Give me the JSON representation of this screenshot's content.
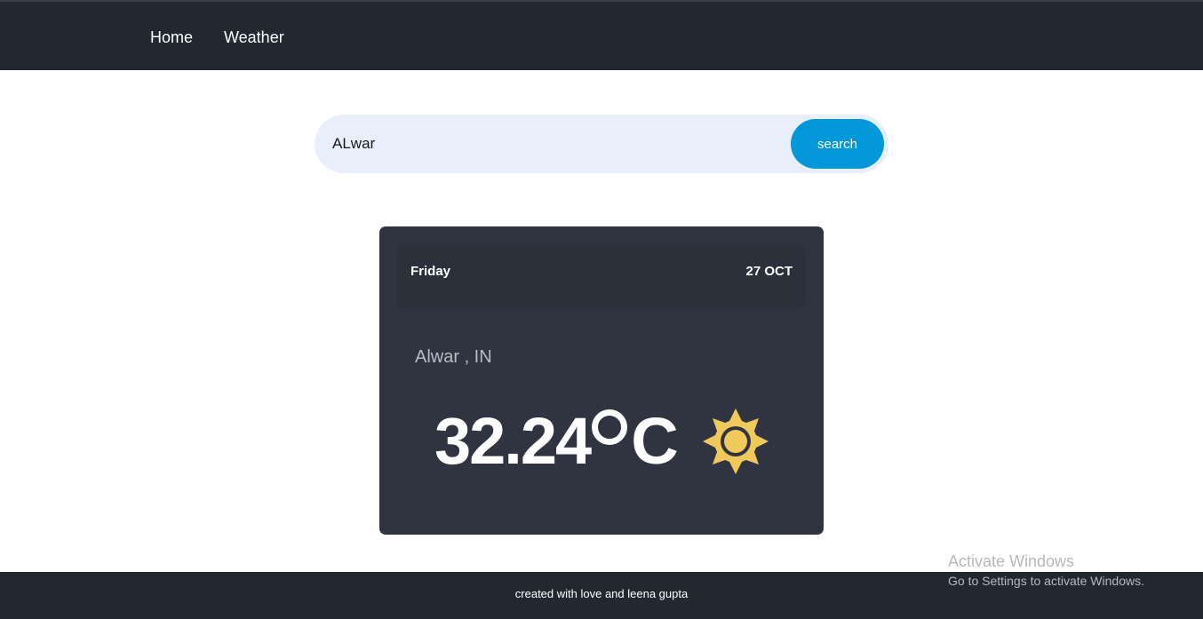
{
  "nav": {
    "items": [
      {
        "label": "Home"
      },
      {
        "label": "Weather"
      }
    ]
  },
  "search": {
    "value": "ALwar",
    "button_label": "search"
  },
  "weather_card": {
    "day": "Friday",
    "date": "27 OCT",
    "location": "Alwar , IN",
    "temperature": "32.24",
    "unit": "C",
    "icon": "sun-icon",
    "icon_color": "#f0c95d"
  },
  "footer": {
    "text": "created with love and leena gupta"
  },
  "watermark": {
    "title": "Activate Windows",
    "subtitle": "Go to Settings to activate Windows."
  }
}
